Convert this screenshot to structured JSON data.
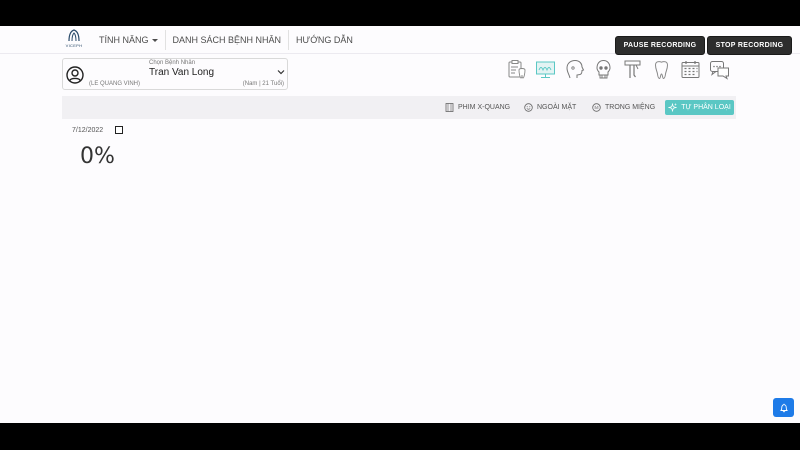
{
  "header": {
    "logo_text": "VICEPH",
    "nav": [
      {
        "label": "TÍNH NĂNG"
      },
      {
        "label": "DANH SÁCH BỆNH NHÂN"
      },
      {
        "label": "HƯỚNG DẪN"
      }
    ],
    "pause_recording": "PAUSE RECORDING",
    "stop_recording": "STOP RECORDING"
  },
  "patient": {
    "choose_label": "Chọn Bệnh Nhân",
    "name": "Tran Van Long",
    "doctor": "(LE QUANG VINH)",
    "info": "(Nam | 21 Tuổi)"
  },
  "toolbar_icons": [
    "clipboard-tooth-icon",
    "xray-monitor-icon",
    "face-profile-icon",
    "skull-icon",
    "dental-tools-icon",
    "tooth-icon",
    "calendar-icon",
    "chat-icon"
  ],
  "filters": {
    "xray": "PHIM X-QUANG",
    "extraoral": "NGOÀI MẶT",
    "intraoral": "TRONG MIỆNG",
    "auto_classify": "TỰ PHÂN LOẠI"
  },
  "content": {
    "date": "7/12/2022",
    "progress": "0%"
  },
  "colors": {
    "accent": "#5ac7c4",
    "dark_button": "#2d2d2d",
    "notification": "#1e7be8"
  }
}
